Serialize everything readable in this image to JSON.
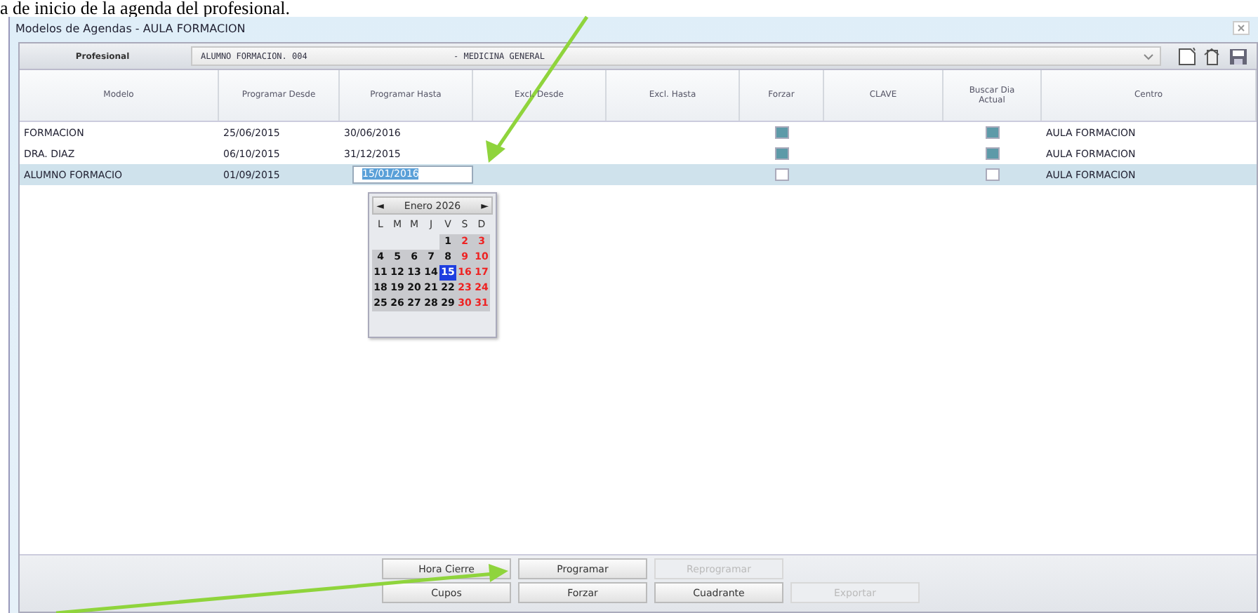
{
  "caption": "a de inicio de la agenda del profesional.",
  "window": {
    "title": "Modelos de Agendas - AULA FORMACION"
  },
  "profesional": {
    "label": "Profesional",
    "value": "ALUMNO FORMACION. 004",
    "specialty": "- MEDICINA GENERAL"
  },
  "table": {
    "columns": [
      "Modelo",
      "Programar Desde",
      "Programar Hasta",
      "Excl. Desde",
      "Excl. Hasta",
      "Forzar",
      "CLAVE",
      "Buscar Dia Actual",
      "Centro"
    ],
    "rows": [
      {
        "modelo": "FORMACION",
        "desde": "25/06/2015",
        "hasta": "30/06/2016",
        "forzar": true,
        "buscar": true,
        "centro": "AULA FORMACION",
        "selected": false
      },
      {
        "modelo": "DRA. DIAZ",
        "desde": "06/10/2015",
        "hasta": "31/12/2015",
        "forzar": true,
        "buscar": true,
        "centro": "AULA FORMACION",
        "selected": false
      },
      {
        "modelo": "ALUMNO FORMACIO",
        "desde": "01/09/2015",
        "hasta": "15/01/2016",
        "editing": true,
        "forzar": false,
        "buscar": false,
        "centro": "AULA FORMACION",
        "selected": true
      }
    ]
  },
  "calendar": {
    "month": "Enero 2026",
    "prev": "◄",
    "next": "►",
    "weekdays": [
      "L",
      "M",
      "M",
      "J",
      "V",
      "S",
      "D"
    ],
    "weeks": [
      [
        {
          "day": "1",
          "selected": false
        },
        {
          "day": "2",
          "selected": false
        },
        {
          "day": "3",
          "selected": false
        }
      ],
      [
        {
          "day": "4",
          "selected": false
        },
        {
          "day": "5",
          "selected": false
        },
        {
          "day": "6",
          "selected": false
        },
        {
          "day": "7",
          "selected": false
        },
        {
          "day": "8",
          "selected": false
        },
        {
          "day": "9",
          "selected": false
        },
        {
          "day": "10",
          "selected": false
        }
      ],
      [
        {
          "day": "11",
          "selected": false
        },
        {
          "day": "12",
          "selected": false
        },
        {
          "day": "13",
          "selected": false
        },
        {
          "day": "14",
          "selected": false
        },
        {
          "day": "15",
          "selected": true
        },
        {
          "day": "16",
          "selected": false
        },
        {
          "day": "17",
          "selected": false
        }
      ],
      [
        {
          "day": "18",
          "selected": false
        },
        {
          "day": "19",
          "selected": false
        },
        {
          "day": "20",
          "selected": false
        },
        {
          "day": "21",
          "selected": false
        },
        {
          "day": "22",
          "selected": false
        },
        {
          "day": "23",
          "selected": false
        },
        {
          "day": "24",
          "selected": false
        }
      ],
      [
        {
          "day": "25",
          "selected": false
        },
        {
          "day": "26",
          "selected": false
        },
        {
          "day": "27",
          "selected": false
        },
        {
          "day": "28",
          "selected": false
        },
        {
          "day": "29",
          "selected": false
        },
        {
          "day": "30",
          "selected": false
        },
        {
          "day": "31",
          "selected": false
        }
      ]
    ]
  },
  "buttons": [
    [
      {
        "label": "Hora Cierre",
        "disabled": false
      },
      {
        "label": "Programar",
        "disabled": false
      },
      {
        "label": "Reprogramar",
        "disabled": true
      }
    ],
    [
      {
        "label": "Cupos",
        "disabled": false
      },
      {
        "label": "Forzar",
        "disabled": false
      },
      {
        "label": "Cuadrante",
        "disabled": false
      },
      {
        "label": "Exportar",
        "disabled": true
      }
    ]
  ]
}
